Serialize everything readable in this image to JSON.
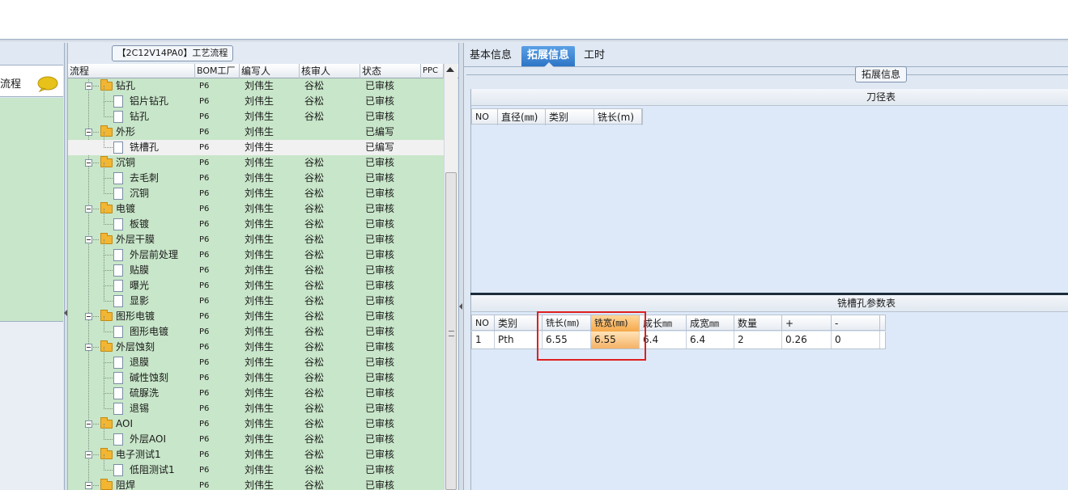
{
  "left_sidebar": {
    "header_label": "流程",
    "chat_icon": "chat-bubble-icon"
  },
  "process_panel": {
    "caption": "【2C12V14PA0】工艺流程",
    "columns": [
      "流程",
      "BOM工厂",
      "编写人",
      "核审人",
      "状态",
      "PPC"
    ],
    "rows": [
      {
        "label": "钻孔",
        "type": "folder",
        "bom": "P6",
        "writer": "刘伟生",
        "reviewer": "谷松",
        "status": "已审核"
      },
      {
        "label": "铝片钻孔",
        "type": "doc",
        "bom": "P6",
        "writer": "刘伟生",
        "reviewer": "谷松",
        "status": "已审核"
      },
      {
        "label": "钻孔",
        "type": "doc",
        "bom": "P6",
        "writer": "刘伟生",
        "reviewer": "谷松",
        "status": "已审核"
      },
      {
        "label": "外形",
        "type": "folder",
        "bom": "P6",
        "writer": "刘伟生",
        "reviewer": "",
        "status": "已编写"
      },
      {
        "label": "铣槽孔",
        "type": "doc",
        "bom": "P6",
        "writer": "刘伟生",
        "reviewer": "",
        "status": "已编写",
        "selected": true
      },
      {
        "label": "沉铜",
        "type": "folder",
        "bom": "P6",
        "writer": "刘伟生",
        "reviewer": "谷松",
        "status": "已审核"
      },
      {
        "label": "去毛刺",
        "type": "doc",
        "bom": "P6",
        "writer": "刘伟生",
        "reviewer": "谷松",
        "status": "已审核"
      },
      {
        "label": "沉铜",
        "type": "doc",
        "bom": "P6",
        "writer": "刘伟生",
        "reviewer": "谷松",
        "status": "已审核"
      },
      {
        "label": "电镀",
        "type": "folder",
        "bom": "P6",
        "writer": "刘伟生",
        "reviewer": "谷松",
        "status": "已审核"
      },
      {
        "label": "板镀",
        "type": "doc",
        "bom": "P6",
        "writer": "刘伟生",
        "reviewer": "谷松",
        "status": "已审核"
      },
      {
        "label": "外层干膜",
        "type": "folder",
        "bom": "P6",
        "writer": "刘伟生",
        "reviewer": "谷松",
        "status": "已审核"
      },
      {
        "label": "外层前处理",
        "type": "doc",
        "bom": "P6",
        "writer": "刘伟生",
        "reviewer": "谷松",
        "status": "已审核"
      },
      {
        "label": "贴膜",
        "type": "doc",
        "bom": "P6",
        "writer": "刘伟生",
        "reviewer": "谷松",
        "status": "已审核"
      },
      {
        "label": "曝光",
        "type": "doc",
        "bom": "P6",
        "writer": "刘伟生",
        "reviewer": "谷松",
        "status": "已审核"
      },
      {
        "label": "显影",
        "type": "doc",
        "bom": "P6",
        "writer": "刘伟生",
        "reviewer": "谷松",
        "status": "已审核"
      },
      {
        "label": "图形电镀",
        "type": "folder",
        "bom": "P6",
        "writer": "刘伟生",
        "reviewer": "谷松",
        "status": "已审核"
      },
      {
        "label": "图形电镀",
        "type": "doc",
        "bom": "P6",
        "writer": "刘伟生",
        "reviewer": "谷松",
        "status": "已审核"
      },
      {
        "label": "外层蚀刻",
        "type": "folder",
        "bom": "P6",
        "writer": "刘伟生",
        "reviewer": "谷松",
        "status": "已审核"
      },
      {
        "label": "退膜",
        "type": "doc",
        "bom": "P6",
        "writer": "刘伟生",
        "reviewer": "谷松",
        "status": "已审核"
      },
      {
        "label": "碱性蚀刻",
        "type": "doc",
        "bom": "P6",
        "writer": "刘伟生",
        "reviewer": "谷松",
        "status": "已审核"
      },
      {
        "label": "硫脲洗",
        "type": "doc",
        "bom": "P6",
        "writer": "刘伟生",
        "reviewer": "谷松",
        "status": "已审核"
      },
      {
        "label": "退锡",
        "type": "doc",
        "bom": "P6",
        "writer": "刘伟生",
        "reviewer": "谷松",
        "status": "已审核"
      },
      {
        "label": "AOI",
        "type": "folder",
        "bom": "P6",
        "writer": "刘伟生",
        "reviewer": "谷松",
        "status": "已审核"
      },
      {
        "label": "外层AOI",
        "type": "doc",
        "bom": "P6",
        "writer": "刘伟生",
        "reviewer": "谷松",
        "status": "已审核"
      },
      {
        "label": "电子测试1",
        "type": "folder",
        "bom": "P6",
        "writer": "刘伟生",
        "reviewer": "谷松",
        "status": "已审核"
      },
      {
        "label": "低阻测试1",
        "type": "doc",
        "bom": "P6",
        "writer": "刘伟生",
        "reviewer": "谷松",
        "status": "已审核"
      },
      {
        "label": "阻焊",
        "type": "folder",
        "bom": "P6",
        "writer": "刘伟生",
        "reviewer": "谷松",
        "status": "已审核"
      }
    ]
  },
  "right_panel": {
    "tabs": [
      "基本信息",
      "拓展信息",
      "工时"
    ],
    "active_tab": 1,
    "group_caption": "拓展信息",
    "tool_table": {
      "title": "刀径表",
      "columns": [
        "NO",
        "直径(㎜)",
        "类别",
        "铣长(m)"
      ]
    },
    "slot_table": {
      "title": "铣槽孔参数表",
      "columns": [
        "NO",
        "类别",
        "铣长(㎜)",
        "铣宽(㎜)",
        "成长㎜",
        "成宽㎜",
        "数量",
        "+",
        "-"
      ],
      "rows": [
        [
          "1",
          "Pth",
          "6.55",
          "6.55",
          "6.4",
          "6.4",
          "2",
          "0.26",
          "0"
        ]
      ]
    }
  }
}
